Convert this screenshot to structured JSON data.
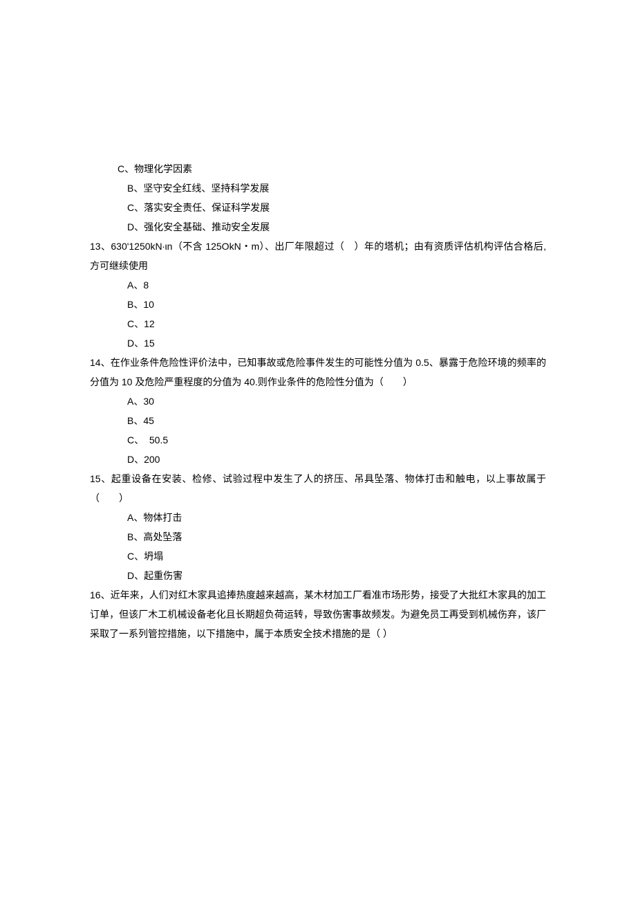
{
  "lines": [
    {
      "class": "option-indent",
      "text": "C、物理化学因素"
    },
    {
      "class": "option",
      "text": "B、坚守安全红线、坚持科学发展"
    },
    {
      "class": "option",
      "text": "C、落实安全责任、保证科学发展"
    },
    {
      "class": "option",
      "text": "D、强化安全基础、推动安全发展"
    },
    {
      "class": "question",
      "text": "13、630'1250kN∙ιn（不含 125OkN・m）、出厂年限超过（　）年的塔机；由有资质评估机构评估合格后, 方可继续使用"
    },
    {
      "class": "option",
      "text": "A、8"
    },
    {
      "class": "option",
      "text": "B、10"
    },
    {
      "class": "option",
      "text": "C、12"
    },
    {
      "class": "option",
      "text": "D、15"
    },
    {
      "class": "question",
      "text": "14、在作业条件危险性评价法中，已知事故或危险事件发生的可能性分值为 0.5、暴露于危险环境的频率的分值为 10 及危险严重程度的分值为 40.则作业条件的危险性分值为（　　）"
    },
    {
      "class": "option",
      "text": "A、30"
    },
    {
      "class": "option",
      "text": "B、45"
    },
    {
      "class": "option",
      "text": "C、 50.5"
    },
    {
      "class": "option",
      "text": "D、200"
    },
    {
      "class": "question",
      "text": "15、起重设备在安装、检修、试验过程中发生了人的挤压、吊具坠落、物体打击和触电，以上事故属于（　　）"
    },
    {
      "class": "option",
      "text": "A、物体打击"
    },
    {
      "class": "option",
      "text": "B、高处坠落"
    },
    {
      "class": "option",
      "text": "C、坍塌"
    },
    {
      "class": "option",
      "text": "D、起重伤害"
    },
    {
      "class": "question",
      "text": "16、近年来，人们对红木家具追捧热度越来越高，某木材加工厂看准市场形势，接受了大批红木家具的加工订单，但该厂木工机械设备老化且长期超负荷运转，导致伤害事故频发。为避免员工再受到机械伤弃，该厂采取了一系列管控措施，以下措施中，属于本质安全技术措施的是（ ）"
    }
  ]
}
